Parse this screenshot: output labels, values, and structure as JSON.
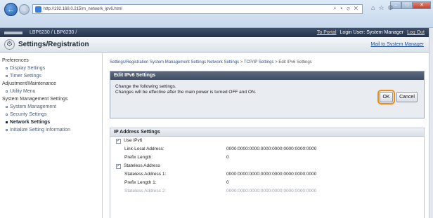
{
  "browser": {
    "url": "http://192.168.0.215/m_network_ipv6.html",
    "address_tools": "⌕ ▾ ⊘ ✕",
    "toolbar_icons": [
      "home-icon",
      "star-icon",
      "gear-icon"
    ]
  },
  "topbar": {
    "model": "LBP6230 / LBP6230 /",
    "to_portal": "To Portal",
    "login_user": "Login User: System Manager",
    "log_out": "Log Out"
  },
  "titlebar": {
    "title": "Settings/Registration",
    "mail_link": "Mail to System Manager"
  },
  "sidebar": {
    "groups": [
      {
        "label": "Preferences",
        "items": [
          {
            "label": "Display Settings"
          },
          {
            "label": "Timer Settings"
          }
        ]
      },
      {
        "label": "Adjustment/Maintenance",
        "items": [
          {
            "label": "Utility Menu"
          }
        ]
      },
      {
        "label": "System Management Settings",
        "items": [
          {
            "label": "System Management"
          },
          {
            "label": "Security Settings"
          },
          {
            "label": "Network Settings",
            "active": true
          },
          {
            "label": "Initialize Setting Information"
          }
        ]
      }
    ]
  },
  "breadcrumb": {
    "items": [
      "Settings/Registration",
      "System Management Settings",
      "Network Settings",
      "TCP/IP Settings"
    ],
    "current": "Edit IPv6 Settings",
    "separator": ">"
  },
  "edit_panel": {
    "title": "Edit IPv6 Settings",
    "message_line1": "Change the following settings.",
    "message_line2": "Changes will be effective after the main power is turned OFF and ON.",
    "ok_label": "OK",
    "cancel_label": "Cancel"
  },
  "ip_settings": {
    "title": "IP Address Settings",
    "use_ipv6_label": "Use IPv6",
    "use_ipv6_checked": true,
    "link_local_label": "Link-Local Address:",
    "link_local_value": "0000:0000:0000:0000:0000:0000:0000:0000",
    "prefix_length_label": "Prefix Length:",
    "prefix_length_value": "0",
    "stateless_label": "Stateless Address",
    "stateless_checked": true,
    "stateless1_label": "Stateless Address 1:",
    "stateless1_value": "0000:0000:0000:0000:0000:0000:0000:0000",
    "prefix_length1_label": "Prefix Length 1:",
    "prefix_length1_value": "0",
    "stateless2_label": "Stateless Address 2:",
    "stateless2_value": "0000:0000:0000:0000:0000:0000:0000:0000"
  },
  "colors": {
    "accent_highlight": "#f08c16",
    "header_dark": "#243349",
    "panel_head": "#404e63"
  }
}
